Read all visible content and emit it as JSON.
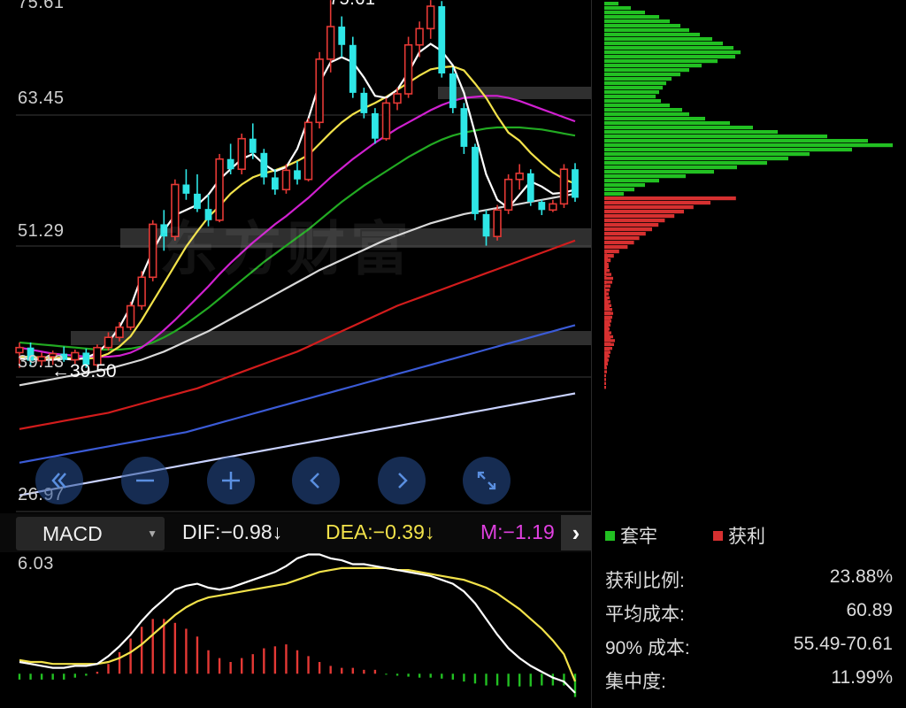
{
  "price_axis": {
    "top": "75.61",
    "mid1": "63.45",
    "mid2": "51.29",
    "low": "39.13",
    "bottom": "26.97"
  },
  "min_marker": "←39.50",
  "high_marker": "75.61",
  "watermark": "东方财富",
  "controls": {
    "scroll_left": "double-chevron-left-icon",
    "zoom_out": "minus-icon",
    "zoom_in": "plus-icon",
    "prev": "chevron-left-icon",
    "next": "chevron-right-icon",
    "fullscreen": "expand-icon"
  },
  "indicator": {
    "name": "MACD",
    "dif": "DIF:−0.98↓",
    "dea": "DEA:−0.39↓",
    "m": "M:−1.19",
    "more": "›"
  },
  "macd_axis": {
    "top": "6.03"
  },
  "chip_legend": {
    "trapped": "套牢",
    "profit": "获利"
  },
  "chip_stats": [
    {
      "label": "获利比例:",
      "value": "23.88%"
    },
    {
      "label": "平均成本:",
      "value": "60.89"
    },
    {
      "label": "90% 成本:",
      "value": "55.49-70.61"
    },
    {
      "label": "集中度:",
      "value": "11.99%"
    }
  ],
  "colors": {
    "up": "#e53935",
    "down": "#2ee6e6",
    "ma5": "#ffffff",
    "ma10": "#f2e24a",
    "ma20": "#d020d0",
    "ma30": "#22aa22",
    "ma60": "#d8d8d8",
    "ma120": "#d21c1c",
    "ma250": "#3b5bd6",
    "ma_long": "#c9d2ff",
    "trapped": "#22c022",
    "profit": "#d63030"
  },
  "chart_data": {
    "type": "candlestick",
    "y_range": [
      26.97,
      75.61
    ],
    "candles": [
      [
        41,
        42,
        39.5,
        41.5
      ],
      [
        41.5,
        42,
        39.6,
        40.2
      ],
      [
        40.2,
        41,
        39.7,
        40.6
      ],
      [
        40.6,
        41.2,
        39.8,
        40.9
      ],
      [
        40.9,
        41.6,
        40.1,
        40.3
      ],
      [
        40.3,
        41.3,
        39.9,
        41.0
      ],
      [
        41.0,
        41.4,
        39.5,
        39.8
      ],
      [
        39.8,
        41.8,
        39.6,
        41.5
      ],
      [
        41.5,
        43,
        41.2,
        42.5
      ],
      [
        42.5,
        44,
        42.1,
        43.5
      ],
      [
        43.5,
        46,
        43.2,
        45.6
      ],
      [
        45.6,
        49,
        45.2,
        48.4
      ],
      [
        48.4,
        54,
        48.0,
        53.6
      ],
      [
        53.6,
        55,
        51.0,
        52.4
      ],
      [
        52.4,
        58,
        52.0,
        57.5
      ],
      [
        57.5,
        59,
        56.0,
        56.6
      ],
      [
        56.6,
        58.5,
        54.8,
        55.1
      ],
      [
        55.1,
        56.5,
        53.4,
        54.0
      ],
      [
        54.0,
        60.5,
        53.8,
        60.0
      ],
      [
        60.0,
        61.5,
        58.5,
        59.0
      ],
      [
        59.0,
        62.5,
        58.5,
        62.0
      ],
      [
        62.0,
        63.5,
        60.0,
        60.6
      ],
      [
        60.6,
        61,
        57.5,
        58.2
      ],
      [
        58.2,
        59,
        56.5,
        57.0
      ],
      [
        57.0,
        59.5,
        56.6,
        58.9
      ],
      [
        58.9,
        59.8,
        57.5,
        58.0
      ],
      [
        58.0,
        64,
        57.8,
        63.6
      ],
      [
        63.6,
        70.5,
        63.0,
        69.8
      ],
      [
        69.8,
        75.6,
        68.5,
        73.0
      ],
      [
        73.0,
        74,
        70.0,
        71.2
      ],
      [
        71.2,
        72,
        66.0,
        66.5
      ],
      [
        66.5,
        67,
        64.0,
        64.5
      ],
      [
        64.5,
        65,
        61.5,
        62.0
      ],
      [
        62.0,
        66,
        61.8,
        65.5
      ],
      [
        65.5,
        67,
        64.8,
        66.4
      ],
      [
        66.4,
        72,
        66.0,
        71.2
      ],
      [
        71.2,
        73.5,
        70.0,
        72.8
      ],
      [
        72.8,
        75.6,
        71.8,
        75.0
      ],
      [
        75.0,
        75.5,
        68.0,
        68.4
      ],
      [
        68.4,
        69,
        64.5,
        65.0
      ],
      [
        65.0,
        65.5,
        60.5,
        61.2
      ],
      [
        61.2,
        61.5,
        54.0,
        54.6
      ],
      [
        54.6,
        55,
        51.5,
        52.4
      ],
      [
        52.4,
        55.5,
        52.0,
        55.0
      ],
      [
        55.0,
        58.5,
        54.6,
        58.0
      ],
      [
        58.0,
        59.5,
        57.0,
        58.6
      ],
      [
        58.6,
        59,
        55.4,
        55.8
      ],
      [
        55.8,
        56,
        54.5,
        55.0
      ],
      [
        55.0,
        56,
        54.8,
        55.6
      ],
      [
        55.6,
        59.5,
        55.2,
        59.0
      ],
      [
        59.0,
        59.6,
        55.8,
        56.2
      ]
    ],
    "lines": {
      "ma5": [
        40.4,
        40.4,
        40.3,
        40.3,
        40.4,
        40.3,
        40.5,
        41.0,
        42.0,
        43.5,
        45.5,
        48.5,
        51.0,
        53.0,
        54.5,
        55.0,
        55.5,
        56.5,
        58.0,
        59.0,
        60.0,
        60.5,
        59.5,
        58.8,
        59.2,
        61.0,
        64.0,
        67.5,
        69.5,
        70.0,
        69.5,
        68.0,
        66.2,
        66.0,
        66.8,
        68.5,
        70.5,
        71.3,
        70.6,
        69.2,
        66.5,
        62.5,
        58.5,
        56.0,
        55.2,
        56.5,
        57.8,
        57.3,
        56.6,
        56.7,
        57.0
      ],
      "ma10": [
        40.6,
        40.6,
        40.5,
        40.5,
        40.5,
        40.4,
        40.4,
        40.5,
        40.9,
        41.6,
        42.6,
        44.2,
        46.0,
        47.8,
        49.6,
        51.4,
        52.9,
        54.3,
        55.4,
        56.6,
        57.5,
        58.2,
        58.6,
        58.9,
        59.3,
        59.8,
        60.4,
        61.5,
        62.6,
        63.6,
        64.4,
        65.0,
        65.5,
        66.1,
        66.8,
        67.5,
        68.2,
        68.8,
        69.0,
        69.1,
        68.7,
        67.4,
        66.0,
        64.2,
        62.6,
        61.8,
        60.6,
        59.6,
        58.7,
        58.0,
        57.6
      ],
      "ma20": [
        41.5,
        41.3,
        41.1,
        40.9,
        40.8,
        40.7,
        40.6,
        40.6,
        40.6,
        40.7,
        41.0,
        41.5,
        42.3,
        43.2,
        44.2,
        45.3,
        46.4,
        47.5,
        48.7,
        49.8,
        50.8,
        51.8,
        52.7,
        53.6,
        54.4,
        55.3,
        56.2,
        57.2,
        58.2,
        59.1,
        60.0,
        60.8,
        61.6,
        62.3,
        63.0,
        63.6,
        64.2,
        64.8,
        65.3,
        65.7,
        66.0,
        66.1,
        66.2,
        66.2,
        66.0,
        65.7,
        65.3,
        64.9,
        64.5,
        64.1,
        63.7
      ],
      "ma30": [
        42.0,
        41.9,
        41.8,
        41.7,
        41.6,
        41.5,
        41.4,
        41.3,
        41.3,
        41.3,
        41.4,
        41.6,
        42.0,
        42.5,
        43.1,
        43.8,
        44.6,
        45.4,
        46.3,
        47.2,
        48.1,
        49.0,
        49.9,
        50.7,
        51.5,
        52.3,
        53.1,
        54.0,
        54.9,
        55.8,
        56.6,
        57.4,
        58.1,
        58.8,
        59.5,
        60.2,
        60.8,
        61.4,
        61.9,
        62.3,
        62.6,
        62.8,
        63.0,
        63.1,
        63.1,
        63.1,
        63.0,
        62.9,
        62.7,
        62.5,
        62.3
      ],
      "ma60": [
        37.8,
        38.0,
        38.2,
        38.4,
        38.6,
        38.8,
        39.0,
        39.2,
        39.4,
        39.7,
        40.0,
        40.3,
        40.7,
        41.1,
        41.6,
        42.1,
        42.6,
        43.1,
        43.7,
        44.3,
        44.9,
        45.5,
        46.1,
        46.7,
        47.3,
        47.9,
        48.5,
        49.1,
        49.6,
        50.1,
        50.6,
        51.1,
        51.6,
        52.1,
        52.5,
        52.9,
        53.3,
        53.7,
        54.0,
        54.3,
        54.6,
        54.8,
        55.0,
        55.2,
        55.4,
        55.6,
        55.8,
        56.0,
        56.2,
        56.4,
        56.6
      ],
      "ma120": [
        33.5,
        33.7,
        33.9,
        34.1,
        34.3,
        34.5,
        34.7,
        34.9,
        35.1,
        35.4,
        35.7,
        36.0,
        36.3,
        36.6,
        36.9,
        37.2,
        37.5,
        37.9,
        38.3,
        38.7,
        39.1,
        39.5,
        39.9,
        40.3,
        40.7,
        41.1,
        41.6,
        42.1,
        42.6,
        43.1,
        43.6,
        44.1,
        44.6,
        45.1,
        45.6,
        46.0,
        46.4,
        46.8,
        47.2,
        47.6,
        48.0,
        48.4,
        48.8,
        49.2,
        49.6,
        50.0,
        50.4,
        50.8,
        51.2,
        51.6,
        52.0
      ],
      "ma250": [
        30.2,
        30.4,
        30.6,
        30.8,
        31.0,
        31.2,
        31.4,
        31.6,
        31.8,
        32.0,
        32.2,
        32.4,
        32.6,
        32.8,
        33.0,
        33.2,
        33.5,
        33.8,
        34.1,
        34.4,
        34.7,
        35.0,
        35.3,
        35.6,
        35.9,
        36.2,
        36.5,
        36.8,
        37.1,
        37.4,
        37.7,
        38.0,
        38.3,
        38.6,
        38.9,
        39.2,
        39.5,
        39.8,
        40.1,
        40.4,
        40.7,
        41.0,
        41.3,
        41.6,
        41.9,
        42.2,
        42.5,
        42.8,
        43.1,
        43.4,
        43.7
      ],
      "ma_long": [
        27.0,
        27.2,
        27.4,
        27.6,
        27.8,
        28.0,
        28.2,
        28.4,
        28.6,
        28.8,
        29.0,
        29.2,
        29.4,
        29.6,
        29.8,
        30.0,
        30.2,
        30.4,
        30.6,
        30.8,
        31.0,
        31.2,
        31.4,
        31.6,
        31.8,
        32.0,
        32.2,
        32.4,
        32.6,
        32.8,
        33.0,
        33.2,
        33.4,
        33.6,
        33.8,
        34.0,
        34.2,
        34.4,
        34.6,
        34.8,
        35.0,
        35.2,
        35.4,
        35.6,
        35.8,
        36.0,
        36.2,
        36.4,
        36.6,
        36.8,
        37.0
      ]
    },
    "macd": {
      "y_range": [
        -1.3,
        6.03
      ],
      "dif": [
        0.6,
        0.5,
        0.4,
        0.3,
        0.3,
        0.4,
        0.4,
        0.5,
        0.9,
        1.4,
        2.0,
        2.7,
        3.3,
        3.8,
        4.3,
        4.5,
        4.6,
        4.4,
        4.3,
        4.4,
        4.6,
        4.8,
        5.0,
        5.2,
        5.5,
        5.9,
        6.1,
        6.1,
        5.9,
        5.8,
        5.6,
        5.6,
        5.5,
        5.4,
        5.3,
        5.2,
        5.1,
        5.0,
        4.8,
        4.6,
        4.2,
        3.6,
        2.8,
        2.0,
        1.3,
        0.8,
        0.4,
        0.1,
        -0.2,
        -0.4,
        -0.98
      ],
      "dea": [
        0.7,
        0.6,
        0.6,
        0.5,
        0.5,
        0.5,
        0.5,
        0.5,
        0.6,
        0.8,
        1.1,
        1.5,
        2.0,
        2.5,
        3.0,
        3.4,
        3.7,
        3.9,
        4.0,
        4.1,
        4.2,
        4.3,
        4.4,
        4.5,
        4.6,
        4.8,
        5.0,
        5.2,
        5.3,
        5.4,
        5.4,
        5.4,
        5.4,
        5.4,
        5.3,
        5.3,
        5.2,
        5.1,
        5.0,
        4.9,
        4.8,
        4.6,
        4.4,
        4.1,
        3.7,
        3.3,
        2.8,
        2.3,
        1.7,
        1.0,
        -0.39
      ],
      "hist": [
        -0.3,
        -0.3,
        -0.3,
        -0.3,
        -0.3,
        -0.2,
        -0.1,
        0.1,
        0.5,
        1.1,
        1.8,
        2.4,
        2.8,
        2.8,
        2.6,
        2.3,
        1.9,
        1.2,
        0.8,
        0.6,
        0.8,
        1.0,
        1.3,
        1.4,
        1.5,
        1.2,
        0.9,
        0.6,
        0.4,
        0.3,
        0.3,
        0.2,
        0.2,
        -0.05,
        -0.1,
        -0.15,
        -0.2,
        -0.2,
        -0.25,
        -0.3,
        -0.4,
        -0.5,
        -0.6,
        -0.6,
        -0.65,
        -0.65,
        -0.65,
        -0.6,
        -0.6,
        -0.6,
        -1.19
      ]
    },
    "chips": {
      "trapped": [
        16,
        30,
        46,
        62,
        74,
        86,
        96,
        108,
        122,
        134,
        146,
        154,
        148,
        128,
        110,
        96,
        86,
        76,
        70,
        66,
        62,
        58,
        64,
        74,
        88,
        96,
        114,
        142,
        168,
        196,
        252,
        298,
        326,
        280,
        232,
        208,
        184,
        150,
        124,
        92,
        62,
        46,
        34,
        22
      ],
      "profit": [
        248,
        200,
        168,
        150,
        132,
        114,
        102,
        90,
        78,
        66,
        56,
        44,
        28,
        18,
        12,
        8,
        6,
        4,
        4,
        4,
        2,
        4,
        4,
        6,
        8,
        10,
        12,
        12,
        10,
        8,
        8,
        10,
        12,
        12,
        10,
        8,
        6,
        6,
        4
      ]
    }
  }
}
